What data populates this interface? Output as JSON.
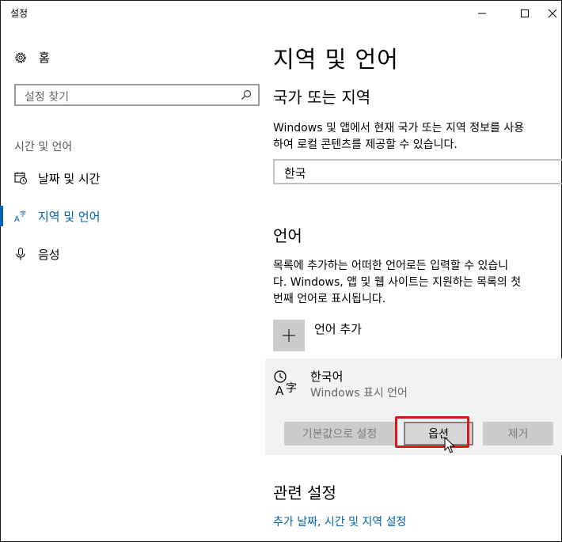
{
  "window": {
    "title": "설정"
  },
  "sidebar": {
    "home_label": "홈",
    "search_placeholder": "설정 찾기",
    "section_label": "시간 및 언어",
    "items": [
      {
        "label": "날짜 및 시간",
        "icon": "calendar-clock-icon"
      },
      {
        "label": "지역 및 언어",
        "icon": "language-icon",
        "active": true
      },
      {
        "label": "음성",
        "icon": "microphone-icon"
      }
    ]
  },
  "main": {
    "title": "지역 및 언어",
    "country_heading": "국가 또는 지역",
    "country_desc_line1": "Windows 및 앱에서 현재 국가 또는 지역 정보를 사용",
    "country_desc_line2": "하여 로컬 콘텐츠를 제공할 수 있습니다.",
    "country_value": "한국",
    "language_heading": "언어",
    "language_desc_line1": "목록에 추가하는 어떠한 언어로든 입력할 수 있습니",
    "language_desc_line2": "다. Windows, 앱 및 웹 사이트는 지원하는 목록의 첫",
    "language_desc_line3": "번째 언어로 표시됩니다.",
    "add_language_label": "언어 추가",
    "language_item": {
      "name": "한국어",
      "subtitle": "Windows 표시 언어",
      "buttons": {
        "set_default": "기본값으로 설정",
        "options": "옵션",
        "remove": "제거"
      }
    },
    "related_heading": "관련 설정",
    "related_link": "추가 날짜, 시간 및 지역 설정"
  },
  "colors": {
    "accent": "#0063b1",
    "highlight": "#e0121c"
  }
}
